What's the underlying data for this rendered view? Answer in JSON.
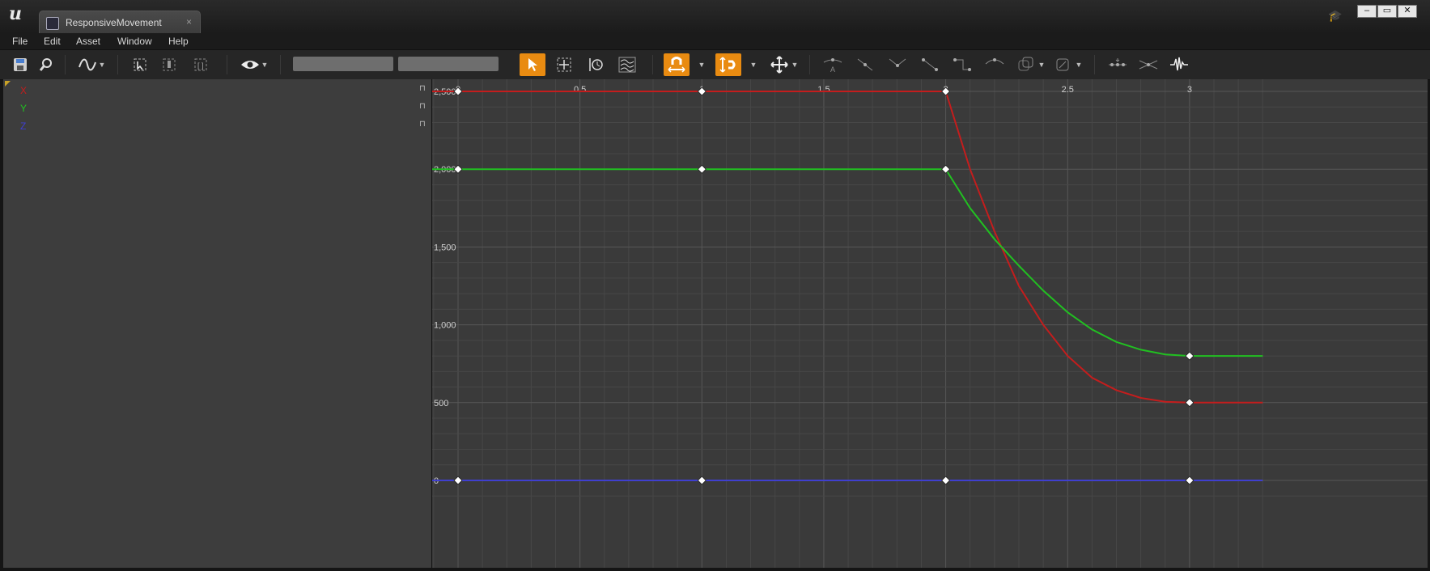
{
  "window": {
    "tab_title": "ResponsiveMovement",
    "tab_close": "×",
    "controls": [
      "–",
      "▭",
      "✕"
    ]
  },
  "menu": [
    "File",
    "Edit",
    "Asset",
    "Window",
    "Help"
  ],
  "toolbar": {
    "icons": [
      "save-icon",
      "browse-icon",
      "curve-type-icon",
      "select-icon",
      "key-icon",
      "frame-icon",
      "visibility-icon",
      "select-mode-icon",
      "transform-mode-icon",
      "retime-mode-icon",
      "multi-curve-icon",
      "snap-value-icon",
      "snap-time-icon",
      "move-icon",
      "auto-tangent-icon",
      "user-tangent-icon",
      "break-tangent-icon",
      "linear-icon",
      "constant-icon",
      "weighted-icon",
      "pre-infinity-icon",
      "post-infinity-icon",
      "flatten-icon",
      "straighten-icon",
      "filter-icon"
    ],
    "accent": "#e98b11"
  },
  "curves": [
    {
      "name": "X",
      "color": "#c41d1d"
    },
    {
      "name": "Y",
      "color": "#21c021"
    },
    {
      "name": "Z",
      "color": "#3f3fcf"
    }
  ],
  "chart_data": {
    "type": "line",
    "x_ticks": [
      "0",
      "0.5",
      "1",
      "1.5",
      "2",
      "2.5",
      "3"
    ],
    "y_ticks": [
      "0",
      "500",
      "1,000",
      "1,500",
      "2,000",
      "2,500"
    ],
    "xlim": [
      -0.3,
      3.3
    ],
    "ylim": [
      -80,
      2600
    ],
    "grid": true,
    "series": [
      {
        "name": "X",
        "color": "#c41d1d",
        "keys": [
          [
            0,
            2500
          ],
          [
            1,
            2500
          ],
          [
            2,
            2500
          ],
          [
            3,
            500
          ]
        ],
        "values": [
          [
            -0.3,
            2500
          ],
          [
            0,
            2500
          ],
          [
            1,
            2500
          ],
          [
            2,
            2500
          ],
          [
            2.1,
            2000
          ],
          [
            2.2,
            1600
          ],
          [
            2.3,
            1250
          ],
          [
            2.4,
            1000
          ],
          [
            2.5,
            800
          ],
          [
            2.6,
            660
          ],
          [
            2.7,
            580
          ],
          [
            2.8,
            530
          ],
          [
            2.9,
            505
          ],
          [
            3,
            500
          ],
          [
            3.3,
            500
          ]
        ]
      },
      {
        "name": "Y",
        "color": "#21c021",
        "keys": [
          [
            0,
            2000
          ],
          [
            1,
            2000
          ],
          [
            2,
            2000
          ],
          [
            3,
            800
          ]
        ],
        "values": [
          [
            -0.3,
            2000
          ],
          [
            0,
            2000
          ],
          [
            1,
            2000
          ],
          [
            2,
            2000
          ],
          [
            2.1,
            1750
          ],
          [
            2.2,
            1550
          ],
          [
            2.3,
            1380
          ],
          [
            2.4,
            1220
          ],
          [
            2.5,
            1080
          ],
          [
            2.6,
            970
          ],
          [
            2.7,
            890
          ],
          [
            2.8,
            840
          ],
          [
            2.9,
            810
          ],
          [
            3,
            800
          ],
          [
            3.3,
            800
          ]
        ]
      },
      {
        "name": "Z",
        "color": "#3f3fcf",
        "keys": [
          [
            0,
            0
          ],
          [
            1,
            0
          ],
          [
            2,
            0
          ],
          [
            3,
            0
          ]
        ],
        "values": [
          [
            -0.3,
            0
          ],
          [
            3.3,
            0
          ]
        ]
      }
    ]
  }
}
